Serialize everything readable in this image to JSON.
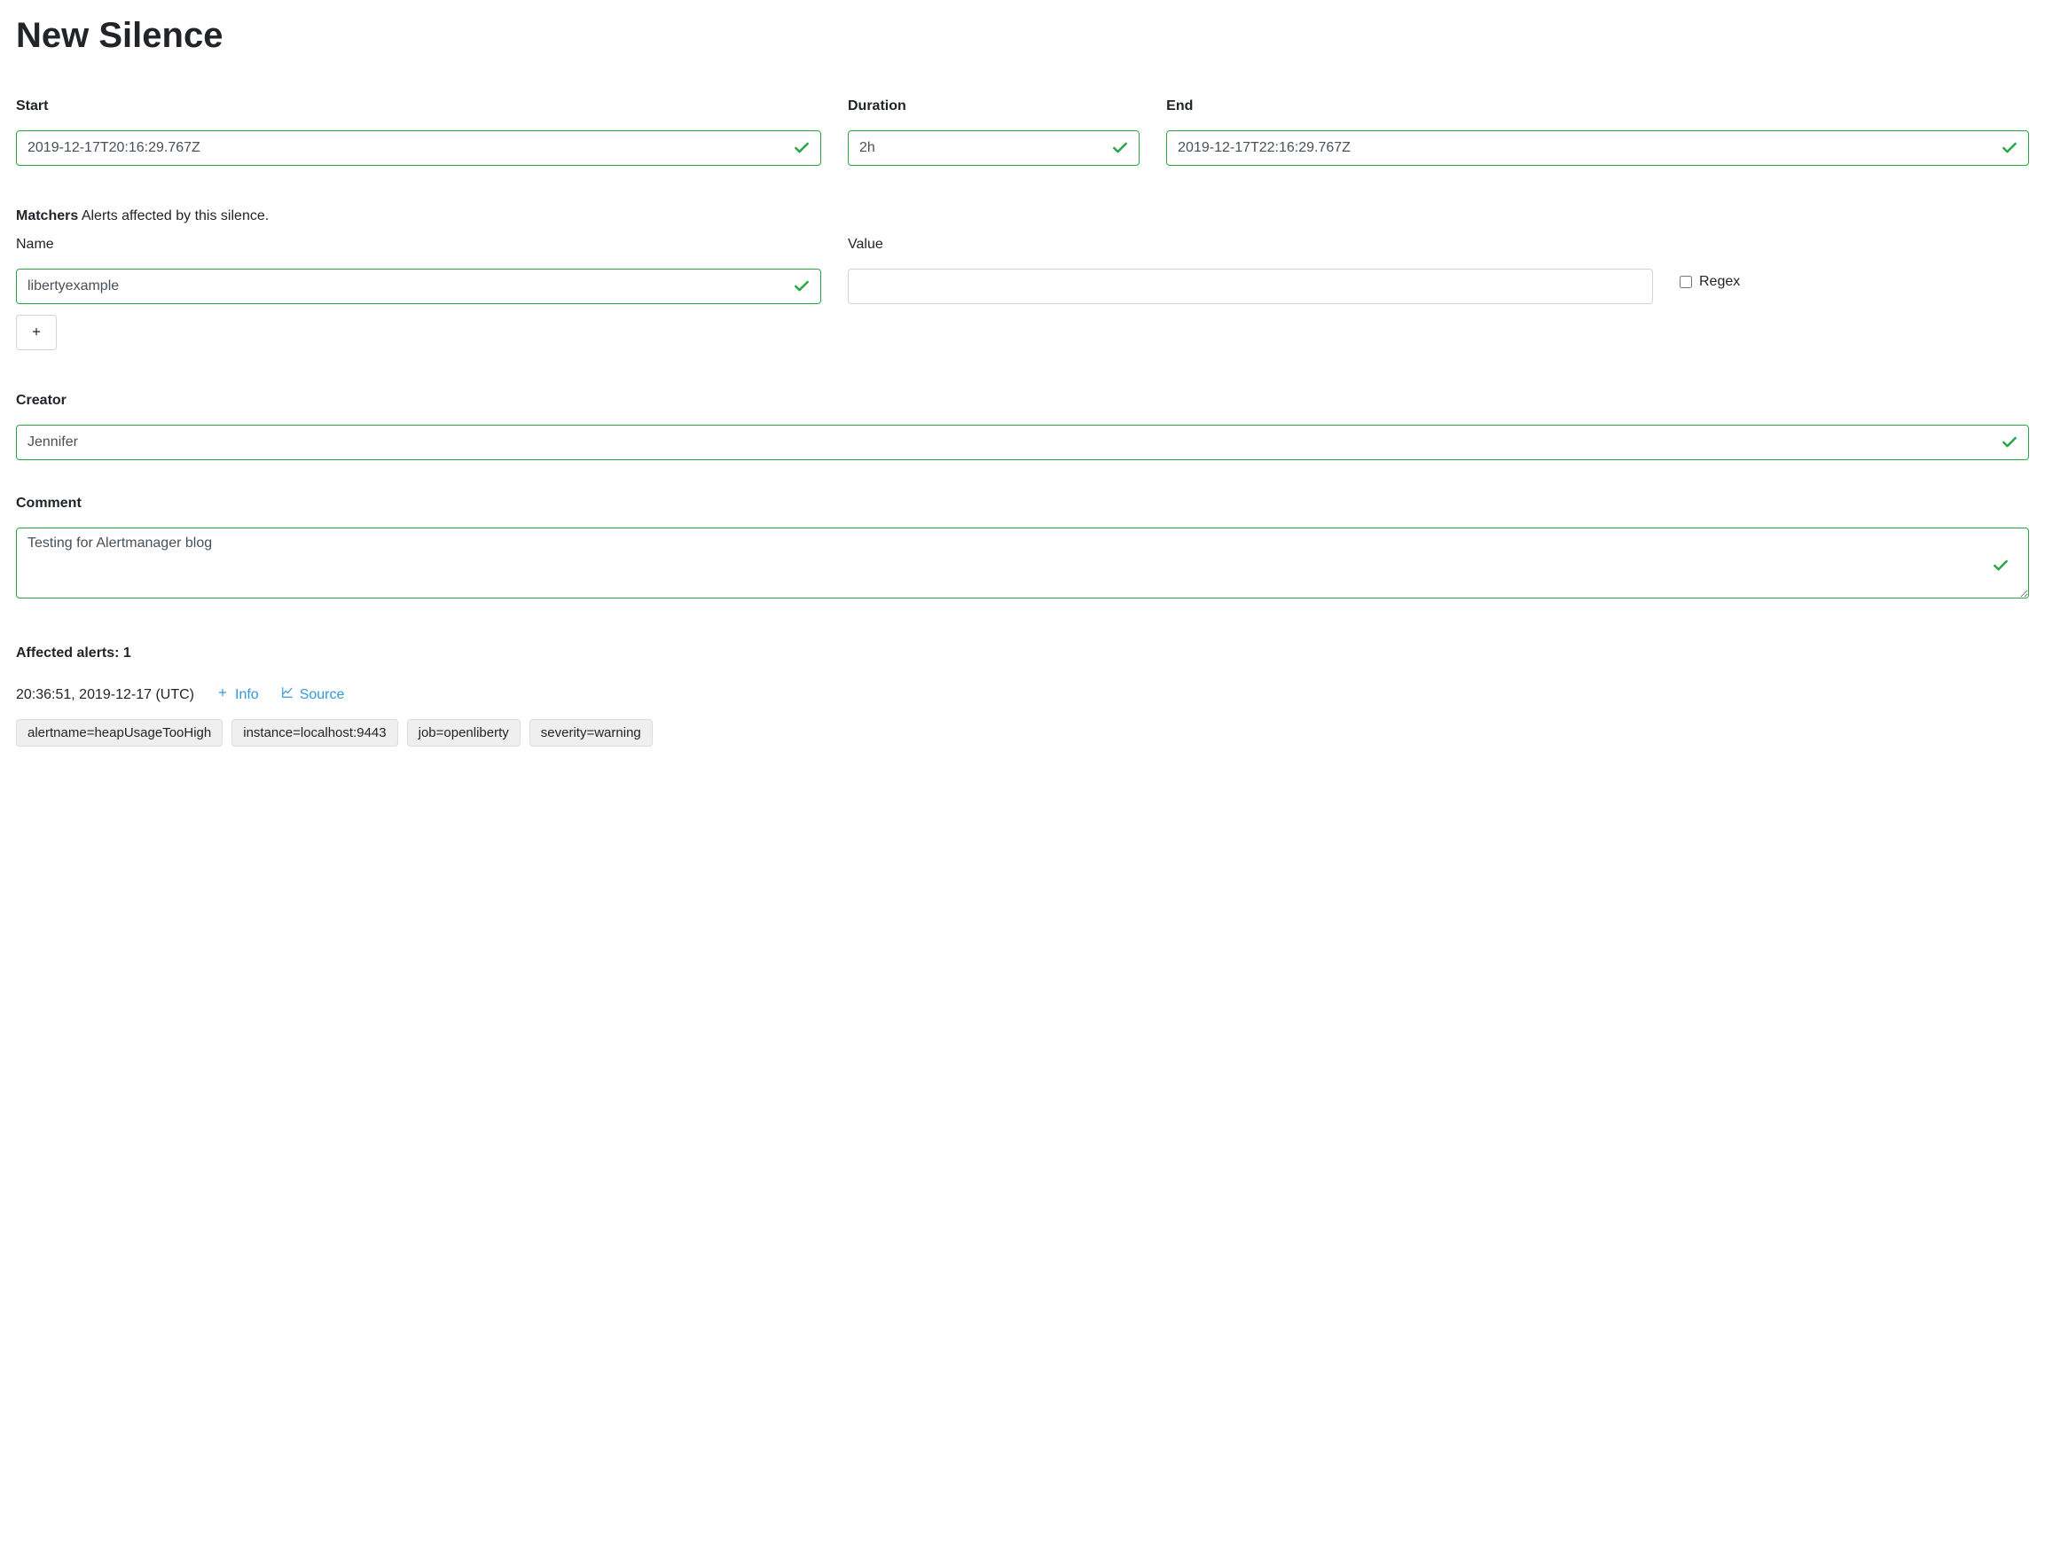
{
  "page_title": "New Silence",
  "start": {
    "label": "Start",
    "value": "2019-12-17T20:16:29.767Z"
  },
  "duration": {
    "label": "Duration",
    "value": "2h"
  },
  "end": {
    "label": "End",
    "value": "2019-12-17T22:16:29.767Z"
  },
  "matchers": {
    "label": "Matchers",
    "description": "Alerts affected by this silence.",
    "name_label": "Name",
    "value_label": "Value",
    "regex_label": "Regex",
    "rows": [
      {
        "name": "libertyexample",
        "value": "",
        "regex": false
      }
    ]
  },
  "creator": {
    "label": "Creator",
    "value": "Jennifer"
  },
  "comment": {
    "label": "Comment",
    "value": "Testing for Alertmanager blog"
  },
  "affected": {
    "label_prefix": "Affected alerts: ",
    "count": "1",
    "alerts": [
      {
        "timestamp": "20:36:51, 2019-12-17 (UTC)",
        "info_label": "Info",
        "source_label": "Source",
        "tags": [
          "alertname=heapUsageTooHigh",
          "instance=localhost:9443",
          "job=openliberty",
          "severity=warning"
        ]
      }
    ]
  }
}
